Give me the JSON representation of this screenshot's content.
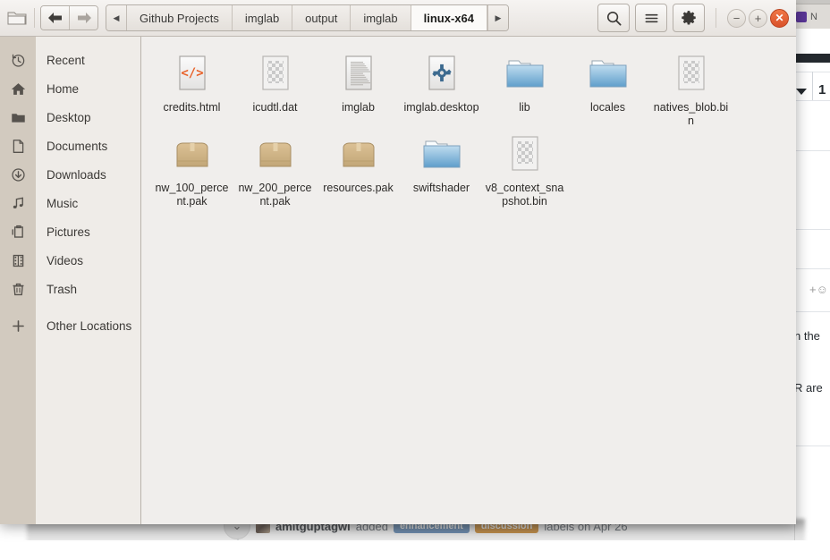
{
  "background": {
    "browser_tab_label": "N",
    "page_number": "1",
    "emoji_button": "+☺",
    "snippets": [
      "n the",
      "R are"
    ]
  },
  "github_timeline": {
    "chevron_icon": "chevron-down-icon",
    "user": "amitguptagwl",
    "action": "added",
    "labels": [
      {
        "text": "enhancement",
        "color": "#5b86b5"
      },
      {
        "text": "discussion",
        "color": "#d08728"
      }
    ],
    "suffix": "labels on Apr 26"
  },
  "file_manager": {
    "header": {
      "window_icon": "folder-icon",
      "back_label": "◀",
      "forward_label": "▶",
      "tab_scroll_left": "◀",
      "tab_scroll_right": "▶",
      "breadcrumb_tabs": [
        {
          "label": "Github Projects",
          "active": false
        },
        {
          "label": "imglab",
          "active": false
        },
        {
          "label": "output",
          "active": false
        },
        {
          "label": "imglab",
          "active": false
        },
        {
          "label": "linux-x64",
          "active": true
        }
      ],
      "actions": [
        {
          "name": "search-button",
          "icon": "search-icon"
        },
        {
          "name": "menu-button",
          "icon": "hamburger-icon"
        },
        {
          "name": "settings-button",
          "icon": "gear-icon"
        }
      ],
      "window_controls": [
        {
          "name": "minimize-button",
          "glyph": "−"
        },
        {
          "name": "maximize-button",
          "glyph": "+"
        },
        {
          "name": "close-button",
          "glyph": "✕"
        }
      ]
    },
    "sidebar": {
      "items": [
        {
          "label": "Recent",
          "icon": "clock-history-icon"
        },
        {
          "label": "Home",
          "icon": "home-icon"
        },
        {
          "label": "Desktop",
          "icon": "folder-icon"
        },
        {
          "label": "Documents",
          "icon": "document-icon"
        },
        {
          "label": "Downloads",
          "icon": "download-icon"
        },
        {
          "label": "Music",
          "icon": "music-note-icon"
        },
        {
          "label": "Pictures",
          "icon": "pictures-icon"
        },
        {
          "label": "Videos",
          "icon": "film-icon"
        },
        {
          "label": "Trash",
          "icon": "trash-icon"
        }
      ],
      "other": {
        "label": "Other Locations",
        "icon": "plus-icon"
      }
    },
    "files": [
      {
        "name": "credits.html",
        "type": "html"
      },
      {
        "name": "icudtl.dat",
        "type": "binary"
      },
      {
        "name": "imglab",
        "type": "text"
      },
      {
        "name": "imglab.desktop",
        "type": "desktop"
      },
      {
        "name": "lib",
        "type": "folder"
      },
      {
        "name": "locales",
        "type": "folder"
      },
      {
        "name": "natives_blob.bin",
        "type": "binary"
      },
      {
        "name": "nw_100_percent.pak",
        "type": "package"
      },
      {
        "name": "nw_200_percent.pak",
        "type": "package"
      },
      {
        "name": "resources.pak",
        "type": "package"
      },
      {
        "name": "swiftshader",
        "type": "folder"
      },
      {
        "name": "v8_context_snapshot.bin",
        "type": "binary"
      }
    ]
  },
  "colors": {
    "sidebar_icon_strip": "#d2cabf",
    "sidebar_list": "#efece8",
    "file_area": "#f0eeec",
    "close_button": "#e0582c",
    "html_icon_accent": "#e8622a",
    "folder_blue": "#6aa8d8",
    "package_tan": "#cdaf80"
  }
}
